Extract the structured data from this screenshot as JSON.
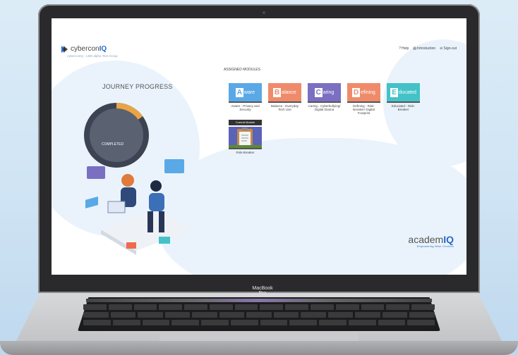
{
  "device": {
    "label": "MacBook Pro"
  },
  "header": {
    "logo_text_plain": "cybercon",
    "logo_text_bold": "IQ",
    "subtitle": "cyberconIQ - LMS alpha Test Group",
    "nav": [
      {
        "icon": "help-icon",
        "label": "Help"
      },
      {
        "icon": "book-icon",
        "label": "Introduction"
      },
      {
        "icon": "signout-icon",
        "label": "Sign-out"
      }
    ]
  },
  "journey": {
    "title": "JOURNEY PROGRESS",
    "status": "COMPLETED",
    "progress_fraction": 0.15
  },
  "assigned": {
    "title": "ASSIGNED MODULES"
  },
  "modules": [
    {
      "cap": "A",
      "rest": "ware",
      "label": "Aware - Privacy and Security",
      "color": "#5aa9e6"
    },
    {
      "cap": "B",
      "rest": "alance",
      "label": "Balance - Everyday Tech Use",
      "color": "#ef8b6a"
    },
    {
      "cap": "C",
      "rest": "aring",
      "label": "Caring - Cyberbullying/ Digital Drama",
      "color": "#7b6fc2"
    },
    {
      "cap": "D",
      "rest": "efining",
      "label": "Defining - Risk-Breaker/ Digital Footprint",
      "color": "#ef8b6a"
    },
    {
      "cap": "E",
      "rest": "ducated",
      "label": "Educated - Risk-Breaker",
      "color": "#43c2c8"
    }
  ],
  "current": {
    "tag": "Current Module",
    "label": "Risk-Breaker"
  },
  "footer_brand": {
    "plain": "academ",
    "bold": "IQ",
    "tagline": "Empowering Wise Choices"
  }
}
